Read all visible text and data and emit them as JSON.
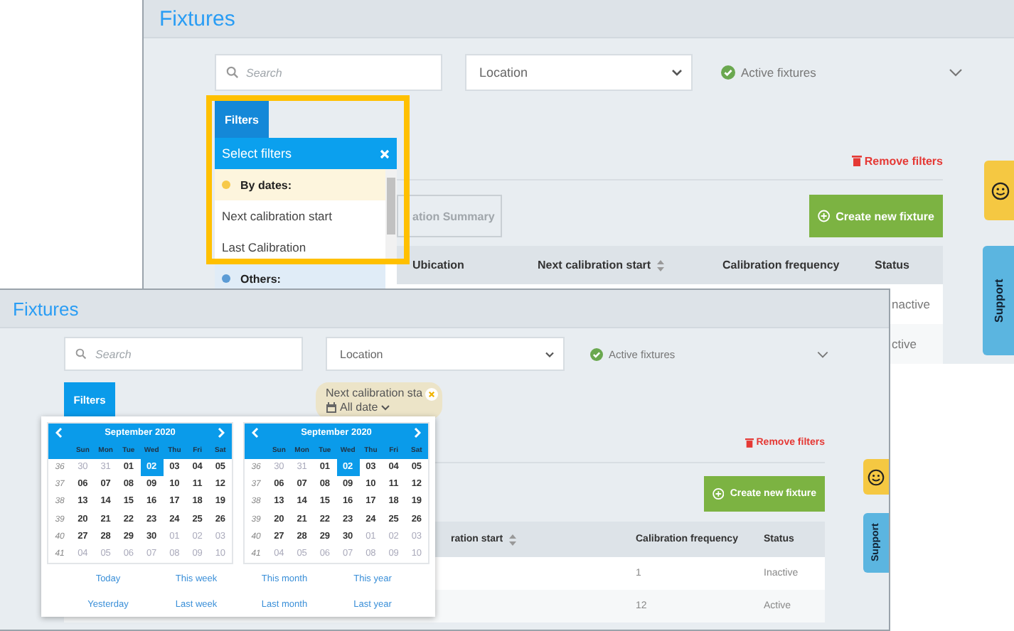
{
  "back_window": {
    "title": "Fixtures",
    "search": {
      "placeholder": "Search"
    },
    "location": "Location",
    "status_filter": "Active fixtures",
    "filters_tab": "Filters",
    "filter_menu": {
      "title": "Select filters",
      "items": [
        {
          "kind": "group",
          "label": "By dates:",
          "color": "#f7c948"
        },
        {
          "kind": "option",
          "label": "Next calibration start"
        },
        {
          "kind": "option",
          "label": "Last Calibration"
        },
        {
          "kind": "group",
          "label": "Others:",
          "color": "#5b9bd5"
        }
      ]
    },
    "remove_filters": "Remove filters",
    "summary_button": "ation Summary",
    "create_button": "Create new fixture",
    "table": {
      "columns": [
        {
          "label": "Ubication",
          "sortable": false
        },
        {
          "label": "Next calibration start",
          "sortable": true
        },
        {
          "label": "Calibration frequency",
          "sortable": false
        },
        {
          "label": "Status",
          "sortable": false
        }
      ],
      "rows": [
        {
          "status": "nactive"
        },
        {
          "status": "ctive"
        }
      ]
    },
    "support": "Support"
  },
  "front_window": {
    "title": "Fixtures",
    "search": {
      "placeholder": "Search"
    },
    "location": "Location",
    "status_filter": "Active fixtures",
    "filters_button": "Filters",
    "date_chip": {
      "label": "Next calibration sta",
      "value": "All date"
    },
    "calendars": [
      {
        "month": "September 2020",
        "weekdays": [
          "Sun",
          "Mon",
          "Tue",
          "Wed",
          "Thu",
          "Fri",
          "Sat"
        ],
        "weeks": [
          {
            "number": "36",
            "days": [
              {
                "day": "30",
                "outside": true,
                "selected": false
              },
              {
                "day": "31",
                "outside": true,
                "selected": false
              },
              {
                "day": "01",
                "outside": false,
                "selected": false
              },
              {
                "day": "02",
                "outside": false,
                "selected": true
              },
              {
                "day": "03",
                "outside": false,
                "selected": false
              },
              {
                "day": "04",
                "outside": false,
                "selected": false
              },
              {
                "day": "05",
                "outside": false,
                "selected": false
              }
            ]
          },
          {
            "number": "37",
            "days": [
              {
                "day": "06",
                "outside": false,
                "selected": false
              },
              {
                "day": "07",
                "outside": false,
                "selected": false
              },
              {
                "day": "08",
                "outside": false,
                "selected": false
              },
              {
                "day": "09",
                "outside": false,
                "selected": false
              },
              {
                "day": "10",
                "outside": false,
                "selected": false
              },
              {
                "day": "11",
                "outside": false,
                "selected": false
              },
              {
                "day": "12",
                "outside": false,
                "selected": false
              }
            ]
          },
          {
            "number": "38",
            "days": [
              {
                "day": "13",
                "outside": false,
                "selected": false
              },
              {
                "day": "14",
                "outside": false,
                "selected": false
              },
              {
                "day": "15",
                "outside": false,
                "selected": false
              },
              {
                "day": "16",
                "outside": false,
                "selected": false
              },
              {
                "day": "17",
                "outside": false,
                "selected": false
              },
              {
                "day": "18",
                "outside": false,
                "selected": false
              },
              {
                "day": "19",
                "outside": false,
                "selected": false
              }
            ]
          },
          {
            "number": "39",
            "days": [
              {
                "day": "20",
                "outside": false,
                "selected": false
              },
              {
                "day": "21",
                "outside": false,
                "selected": false
              },
              {
                "day": "22",
                "outside": false,
                "selected": false
              },
              {
                "day": "23",
                "outside": false,
                "selected": false
              },
              {
                "day": "24",
                "outside": false,
                "selected": false
              },
              {
                "day": "25",
                "outside": false,
                "selected": false
              },
              {
                "day": "26",
                "outside": false,
                "selected": false
              }
            ]
          },
          {
            "number": "40",
            "days": [
              {
                "day": "27",
                "outside": false,
                "selected": false
              },
              {
                "day": "28",
                "outside": false,
                "selected": false
              },
              {
                "day": "29",
                "outside": false,
                "selected": false
              },
              {
                "day": "30",
                "outside": false,
                "selected": false
              },
              {
                "day": "01",
                "outside": true,
                "selected": false
              },
              {
                "day": "02",
                "outside": true,
                "selected": false
              },
              {
                "day": "03",
                "outside": true,
                "selected": false
              }
            ]
          },
          {
            "number": "41",
            "days": [
              {
                "day": "04",
                "outside": true,
                "selected": false
              },
              {
                "day": "05",
                "outside": true,
                "selected": false
              },
              {
                "day": "06",
                "outside": true,
                "selected": false
              },
              {
                "day": "07",
                "outside": true,
                "selected": false
              },
              {
                "day": "08",
                "outside": true,
                "selected": false
              },
              {
                "day": "09",
                "outside": true,
                "selected": false
              },
              {
                "day": "10",
                "outside": true,
                "selected": false
              }
            ]
          }
        ]
      },
      {
        "month": "September 2020",
        "weekdays": [
          "Sun",
          "Mon",
          "Tue",
          "Wed",
          "Thu",
          "Fri",
          "Sat"
        ],
        "weeks": [
          {
            "number": "36",
            "days": [
              {
                "day": "30",
                "outside": true,
                "selected": false
              },
              {
                "day": "31",
                "outside": true,
                "selected": false
              },
              {
                "day": "01",
                "outside": false,
                "selected": false
              },
              {
                "day": "02",
                "outside": false,
                "selected": true
              },
              {
                "day": "03",
                "outside": false,
                "selected": false
              },
              {
                "day": "04",
                "outside": false,
                "selected": false
              },
              {
                "day": "05",
                "outside": false,
                "selected": false
              }
            ]
          },
          {
            "number": "37",
            "days": [
              {
                "day": "06",
                "outside": false,
                "selected": false
              },
              {
                "day": "07",
                "outside": false,
                "selected": false
              },
              {
                "day": "08",
                "outside": false,
                "selected": false
              },
              {
                "day": "09",
                "outside": false,
                "selected": false
              },
              {
                "day": "10",
                "outside": false,
                "selected": false
              },
              {
                "day": "11",
                "outside": false,
                "selected": false
              },
              {
                "day": "12",
                "outside": false,
                "selected": false
              }
            ]
          },
          {
            "number": "38",
            "days": [
              {
                "day": "13",
                "outside": false,
                "selected": false
              },
              {
                "day": "14",
                "outside": false,
                "selected": false
              },
              {
                "day": "15",
                "outside": false,
                "selected": false
              },
              {
                "day": "16",
                "outside": false,
                "selected": false
              },
              {
                "day": "17",
                "outside": false,
                "selected": false
              },
              {
                "day": "18",
                "outside": false,
                "selected": false
              },
              {
                "day": "19",
                "outside": false,
                "selected": false
              }
            ]
          },
          {
            "number": "39",
            "days": [
              {
                "day": "20",
                "outside": false,
                "selected": false
              },
              {
                "day": "21",
                "outside": false,
                "selected": false
              },
              {
                "day": "22",
                "outside": false,
                "selected": false
              },
              {
                "day": "23",
                "outside": false,
                "selected": false
              },
              {
                "day": "24",
                "outside": false,
                "selected": false
              },
              {
                "day": "25",
                "outside": false,
                "selected": false
              },
              {
                "day": "26",
                "outside": false,
                "selected": false
              }
            ]
          },
          {
            "number": "40",
            "days": [
              {
                "day": "27",
                "outside": false,
                "selected": false
              },
              {
                "day": "28",
                "outside": false,
                "selected": false
              },
              {
                "day": "29",
                "outside": false,
                "selected": false
              },
              {
                "day": "30",
                "outside": false,
                "selected": false
              },
              {
                "day": "01",
                "outside": true,
                "selected": false
              },
              {
                "day": "02",
                "outside": true,
                "selected": false
              },
              {
                "day": "03",
                "outside": true,
                "selected": false
              }
            ]
          },
          {
            "number": "41",
            "days": [
              {
                "day": "04",
                "outside": true,
                "selected": false
              },
              {
                "day": "05",
                "outside": true,
                "selected": false
              },
              {
                "day": "06",
                "outside": true,
                "selected": false
              },
              {
                "day": "07",
                "outside": true,
                "selected": false
              },
              {
                "day": "08",
                "outside": true,
                "selected": false
              },
              {
                "day": "09",
                "outside": true,
                "selected": false
              },
              {
                "day": "10",
                "outside": true,
                "selected": false
              }
            ]
          }
        ]
      }
    ],
    "quick_ranges": [
      "Today",
      "This week",
      "This month",
      "This year",
      "Yesterday",
      "Last week",
      "Last month",
      "Last year"
    ],
    "remove_filters": "Remove filters",
    "create_button": "Create new fixture",
    "table": {
      "columns": [
        {
          "label": "ration start",
          "sortable": true
        },
        {
          "label": "Calibration frequency",
          "sortable": false
        },
        {
          "label": "Status",
          "sortable": false
        }
      ],
      "rows": [
        {
          "frequency": "1",
          "status": "Inactive"
        },
        {
          "frequency": "12",
          "status": "Active"
        }
      ]
    },
    "support": "Support"
  }
}
